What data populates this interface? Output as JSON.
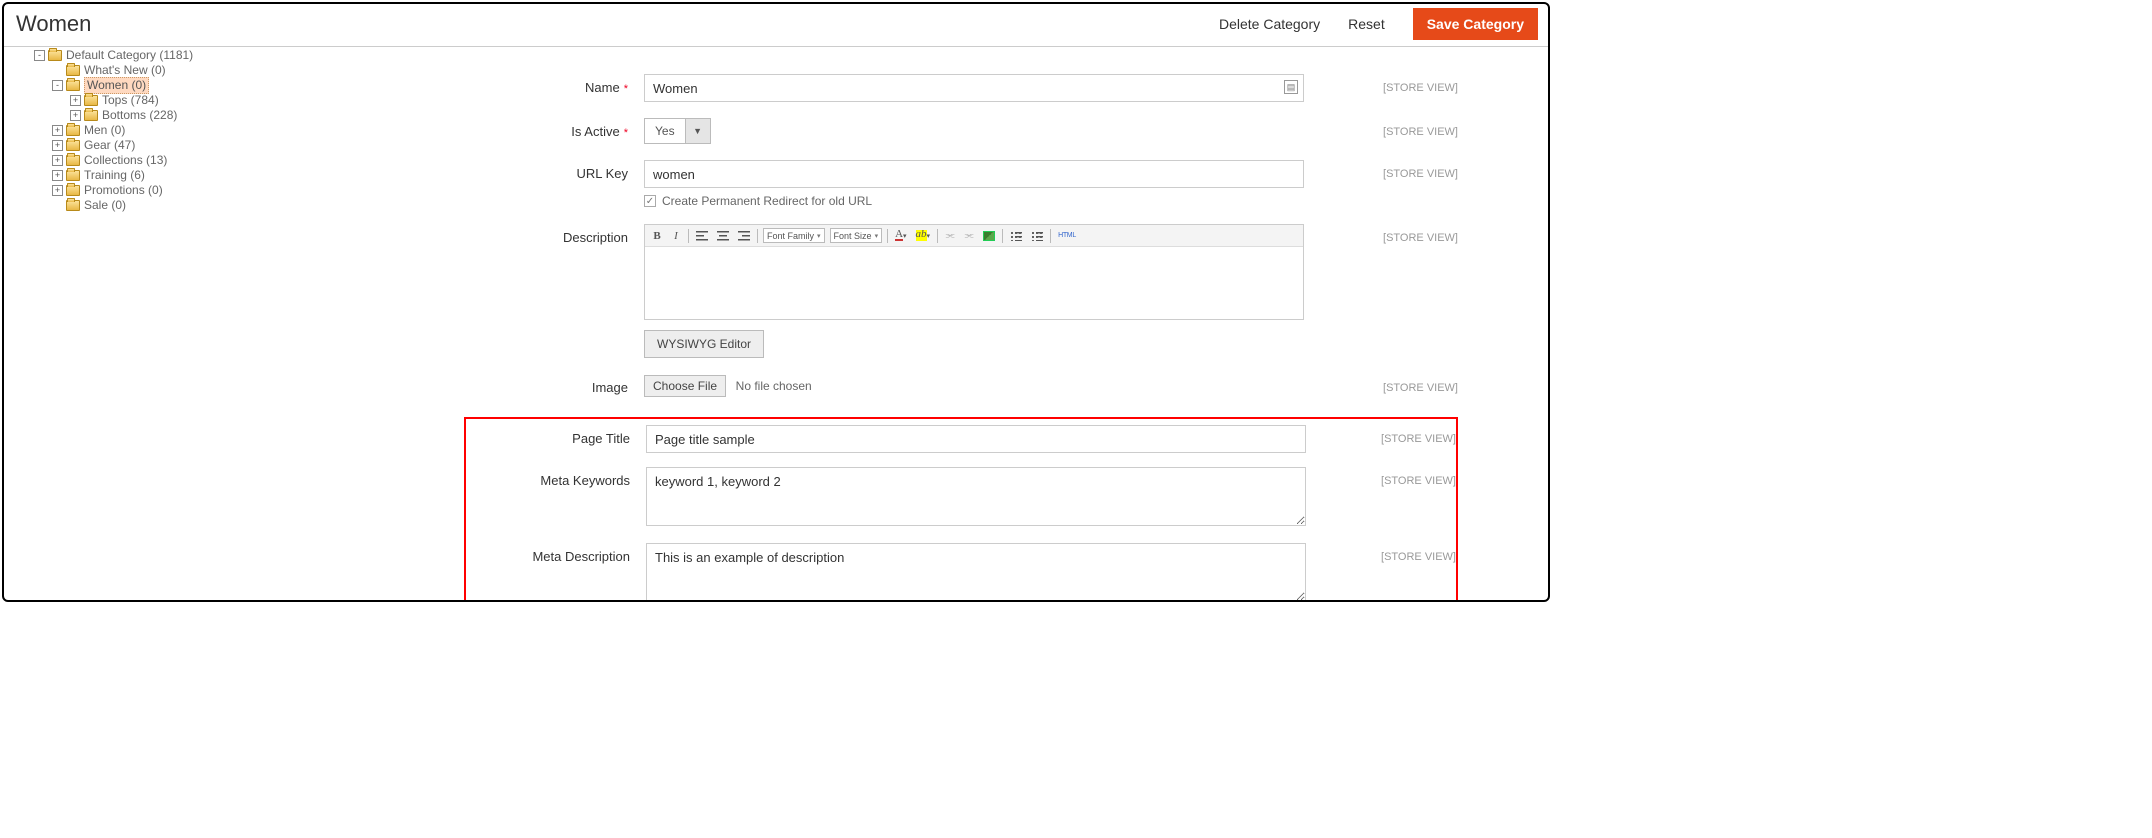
{
  "header": {
    "title": "Women",
    "delete_label": "Delete Category",
    "reset_label": "Reset",
    "save_label": "Save Category"
  },
  "scope_label": "[STORE VIEW]",
  "tree": [
    {
      "indent": 0,
      "toggle": "-",
      "label": "Default Category (1181)",
      "selected": false
    },
    {
      "indent": 1,
      "toggle": " ",
      "label": "What's New (0)",
      "selected": false
    },
    {
      "indent": 1,
      "toggle": "-",
      "label": "Women (0)",
      "selected": true
    },
    {
      "indent": 2,
      "toggle": "+",
      "label": "Tops (784)",
      "selected": false
    },
    {
      "indent": 2,
      "toggle": "+",
      "label": "Bottoms (228)",
      "selected": false
    },
    {
      "indent": 1,
      "toggle": "+",
      "label": "Men (0)",
      "selected": false
    },
    {
      "indent": 1,
      "toggle": "+",
      "label": "Gear (47)",
      "selected": false
    },
    {
      "indent": 1,
      "toggle": "+",
      "label": "Collections (13)",
      "selected": false
    },
    {
      "indent": 1,
      "toggle": "+",
      "label": "Training (6)",
      "selected": false
    },
    {
      "indent": 1,
      "toggle": "+",
      "label": "Promotions (0)",
      "selected": false
    },
    {
      "indent": 1,
      "toggle": " ",
      "label": "Sale (0)",
      "selected": false
    }
  ],
  "form": {
    "name": {
      "label": "Name",
      "value": "Women",
      "required": true
    },
    "is_active": {
      "label": "Is Active",
      "value": "Yes",
      "required": true
    },
    "url_key": {
      "label": "URL Key",
      "value": "women",
      "redirect_label": "Create Permanent Redirect for old URL"
    },
    "description": {
      "label": "Description",
      "editor_btn": "WYSIWYG Editor",
      "toolbar": {
        "font_family": "Font Family",
        "font_size": "Font Size",
        "html": "HTML"
      }
    },
    "image": {
      "label": "Image",
      "choose": "Choose File",
      "state": "No file chosen"
    },
    "page_title": {
      "label": "Page Title",
      "value": "Page title sample"
    },
    "meta_keywords": {
      "label": "Meta Keywords",
      "value": "keyword 1, keyword 2"
    },
    "meta_description": {
      "label": "Meta Description",
      "value": "This is an example of description"
    }
  }
}
